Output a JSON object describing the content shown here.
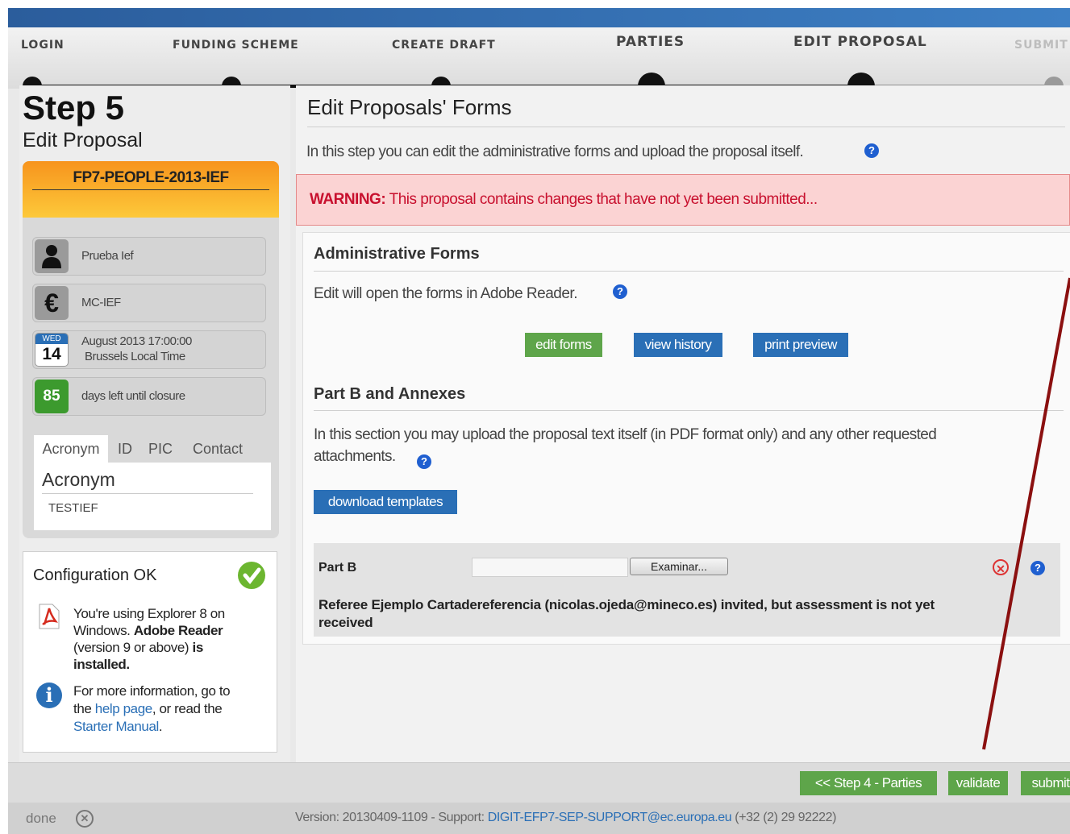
{
  "wizard": {
    "steps": [
      {
        "label": "LOGIN",
        "state": "done"
      },
      {
        "label": "FUNDING SCHEME",
        "state": "done"
      },
      {
        "label": "CREATE DRAFT",
        "state": "done"
      },
      {
        "label": "PARTIES",
        "state": "done"
      },
      {
        "label": "EDIT PROPOSAL",
        "state": "current"
      },
      {
        "label": "SUBMIT",
        "state": "pending"
      }
    ]
  },
  "sidebar": {
    "step_title": "Step 5",
    "step_subtitle": "Edit Proposal",
    "call_id": "FP7-PEOPLE-2013-IEF",
    "user": "Prueba Ief",
    "scheme": "MC-IEF",
    "calendar": {
      "weekday": "WED",
      "day": "14"
    },
    "deadline_line1": "August 2013 17:00:00",
    "deadline_line2": "Brussels Local Time",
    "days_left": "85",
    "days_left_label": "days left until closure",
    "tabs": [
      "Acronym",
      "ID",
      "PIC",
      "Contact"
    ],
    "tab_panel_title": "Acronym",
    "tab_panel_value": "TESTIEF",
    "config": {
      "title": "Configuration OK",
      "pdf_text_1": "You're using Explorer 8 on",
      "pdf_text_2": "Windows.",
      "pdf_text_2b": "Adobe Reader",
      "pdf_text_3": "(version 9 or above)",
      "pdf_text_3b": "is",
      "pdf_text_4": "installed.",
      "info_text_1": "For more information, go to",
      "info_text_2a": "the",
      "info_link_1": "help page",
      "info_text_2b": ", or read the",
      "info_link_2": "Starter Manual",
      "info_text_3": "."
    }
  },
  "main": {
    "title": "Edit Proposals' Forms",
    "intro": "In this step you can edit the administrative forms and upload the proposal itself.",
    "warning_label": "WARNING:",
    "warning_text": "This proposal contains changes that have not yet been submitted...",
    "admin": {
      "heading": "Administrative Forms",
      "text": "Edit will open the forms in Adobe Reader.",
      "buttons": {
        "edit": "edit forms",
        "history": "view history",
        "print": "print preview"
      }
    },
    "partb": {
      "heading": "Part B and Annexes",
      "text_1": "In this section you may upload the proposal text itself (in PDF format only) and any other requested",
      "text_2": "attachments.",
      "download_button": "download templates",
      "row_label": "Part B",
      "file_value": "",
      "browse_button": "Examinar...",
      "referee_1": "Referee Ejemplo Cartadereferencia (nicolas.ojeda@mineco.es) invited, but assessment is not yet",
      "referee_2": "received"
    }
  },
  "nav": {
    "back": "<< Step 4 - Parties",
    "validate": "validate",
    "submit": "submit"
  },
  "status": {
    "done": "done",
    "version_prefix": "Version: 20130409-1109 - Support: ",
    "support_email": "DIGIT-EFP7-SEP-SUPPORT@ec.europa.eu",
    "phone": " (+32 (2) 29 92222)"
  },
  "colors": {
    "accent_blue": "#2a6fb6",
    "accent_green": "#5ea54a",
    "warning_bg": "#fbd3d3",
    "warning_text": "#c8102e",
    "call_orange": "#f7a21b",
    "annotation_arrow": "#8b1010"
  }
}
